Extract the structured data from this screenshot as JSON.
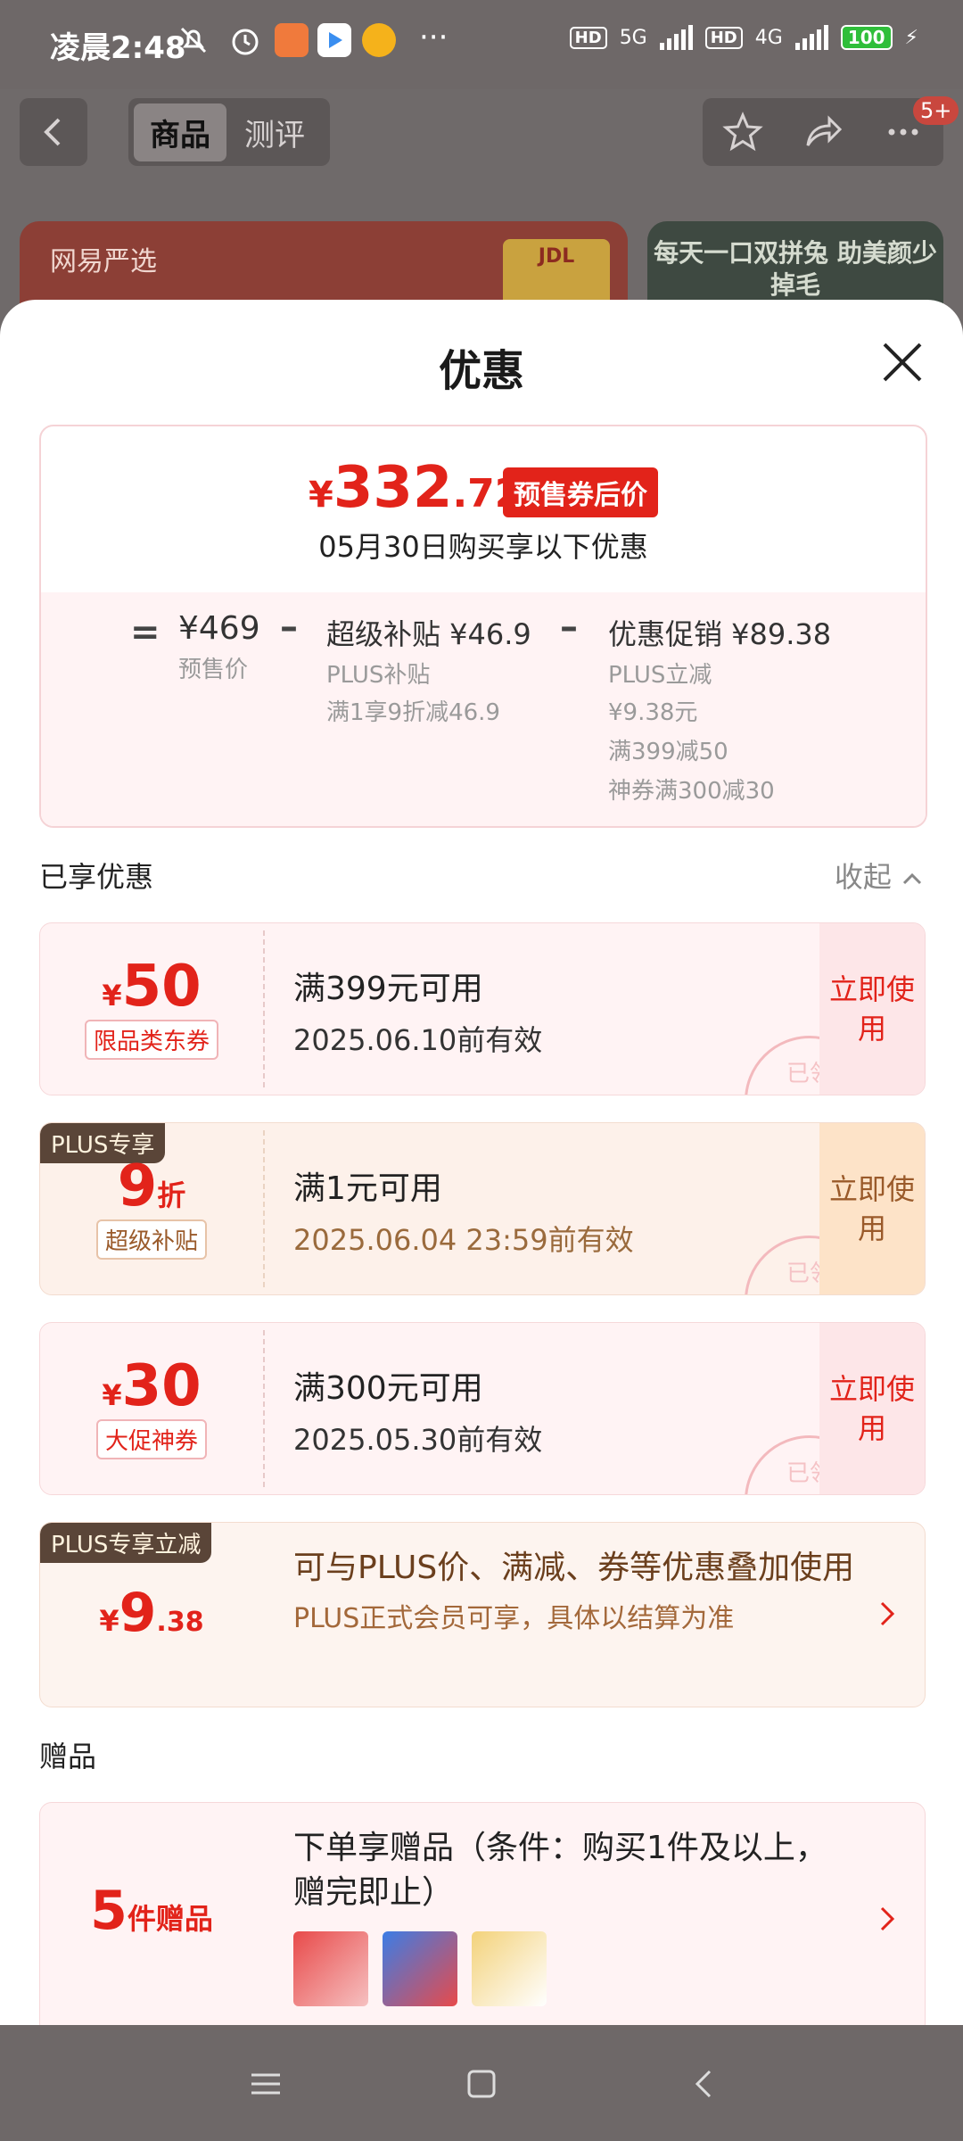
{
  "status_bar": {
    "time": "凌晨2:48",
    "more": "···",
    "hd1": "HD",
    "net1": "5G",
    "hd2": "HD",
    "net2": "4G",
    "battery": "100"
  },
  "background_page": {
    "tabs": [
      "商品",
      "测评"
    ],
    "badge": "5+",
    "banner_left_brand": "网易严选",
    "banner_left_jdl": "JDL",
    "banner_right_text": "每天一口双拼兔 助美颜少掉毛"
  },
  "sheet": {
    "title": "优惠",
    "price": {
      "yen": "¥",
      "integer": "332",
      "decimal": ".72",
      "tag": "预售券后价",
      "subtitle": "05月30日购买享以下优惠"
    },
    "breakdown": {
      "eq": "=",
      "presale_amount": "¥469",
      "presale_label": "预售价",
      "minus": "–",
      "subsidy_title": "超级补贴 ¥46.9",
      "subsidy_line1": "PLUS补贴",
      "subsidy_line2": "满1享9折减46.9",
      "promo_title": "优惠促销 ¥89.38",
      "promo_line1": "PLUS立减",
      "promo_line2": "¥9.38元",
      "promo_line3": "满399减50",
      "promo_line4": "神券满300减30"
    },
    "enjoyed_title": "已享优惠",
    "collapse_label": "收起",
    "coupons": [
      {
        "yen": "¥",
        "value": "50",
        "tag": "限品类东券",
        "cond": "满399元可用",
        "valid": "2025.06.10前有效",
        "action": "立即使用",
        "stamp": "已领"
      },
      {
        "plus": "PLUS专享",
        "value": "9",
        "unit": "折",
        "tag": "超级补贴",
        "cond": "满1元可用",
        "valid": "2025.06.04 23:59前有效",
        "action": "立即使用",
        "stamp": "已领"
      },
      {
        "yen": "¥",
        "value": "30",
        "tag": "大促神券",
        "cond": "满300元可用",
        "valid": "2025.05.30前有效",
        "action": "立即使用",
        "stamp": "已领"
      }
    ],
    "plus_reduce": {
      "tag": "PLUS专享立减",
      "yen": "¥",
      "value": "9",
      "decimal": ".38",
      "line1": "可与PLUS价、满减、券等优惠叠加使用",
      "line2": "PLUS正式会员可享，具体以结算为准"
    },
    "gift_title": "赠品",
    "gift": {
      "count": "5",
      "unit": "件赠品",
      "line1": "下单享赠品（条件：购买1件及以上，赠完即止）"
    }
  }
}
